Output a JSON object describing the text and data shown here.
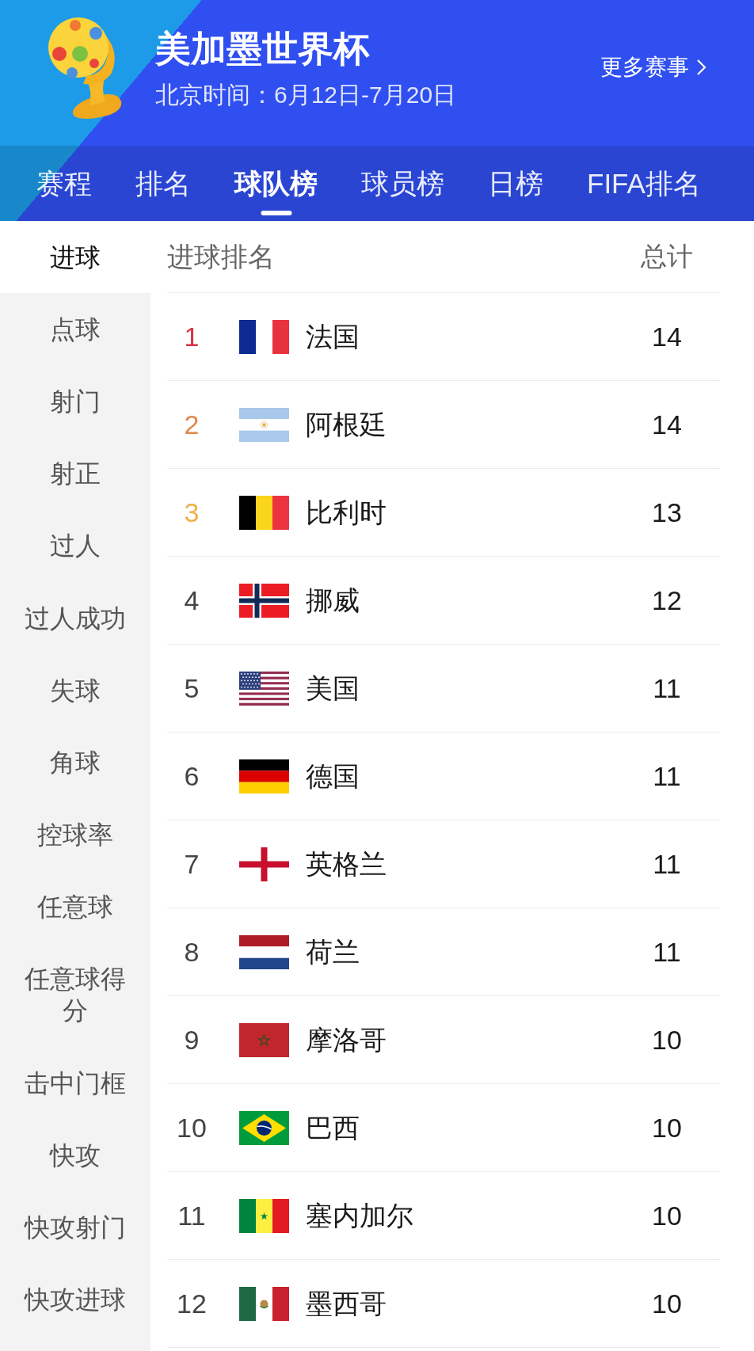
{
  "header": {
    "title": "美加墨世界杯",
    "subtitle": "北京时间：6月12日-7月20日",
    "more_link": "更多赛事"
  },
  "tabs": [
    {
      "label": "赛程",
      "selected": false
    },
    {
      "label": "排名",
      "selected": false
    },
    {
      "label": "球队榜",
      "selected": true
    },
    {
      "label": "球员榜",
      "selected": false
    },
    {
      "label": "日榜",
      "selected": false
    },
    {
      "label": "FIFA排名",
      "selected": false
    }
  ],
  "sidebar": {
    "items": [
      {
        "label": "进球",
        "selected": true
      },
      {
        "label": "点球",
        "selected": false
      },
      {
        "label": "射门",
        "selected": false
      },
      {
        "label": "射正",
        "selected": false
      },
      {
        "label": "过人",
        "selected": false
      },
      {
        "label": "过人成功",
        "selected": false
      },
      {
        "label": "失球",
        "selected": false
      },
      {
        "label": "角球",
        "selected": false
      },
      {
        "label": "控球率",
        "selected": false
      },
      {
        "label": "任意球",
        "selected": false
      },
      {
        "label": "任意球得分",
        "selected": false
      },
      {
        "label": "击中门框",
        "selected": false
      },
      {
        "label": "快攻",
        "selected": false
      },
      {
        "label": "快攻射门",
        "selected": false
      },
      {
        "label": "快攻进球",
        "selected": false
      }
    ]
  },
  "table": {
    "columns": [
      "进球排名",
      "总计"
    ],
    "rows": [
      {
        "rank": "1",
        "color": "#d7333f",
        "kind": "france",
        "team": "法国",
        "total": "14"
      },
      {
        "rank": "2",
        "color": "#e0884e",
        "kind": "argentina",
        "team": "阿根廷",
        "total": "14"
      },
      {
        "rank": "3",
        "color": "#eeb048",
        "kind": "belgium",
        "team": "比利时",
        "total": "13"
      },
      {
        "rank": "4",
        "color": "#444444",
        "kind": "norway",
        "team": "挪威",
        "total": "12"
      },
      {
        "rank": "5",
        "color": "#444444",
        "kind": "usa",
        "team": "美国",
        "total": "11"
      },
      {
        "rank": "6",
        "color": "#444444",
        "kind": "germany",
        "team": "德国",
        "total": "11"
      },
      {
        "rank": "7",
        "color": "#444444",
        "kind": "england",
        "team": "英格兰",
        "total": "11"
      },
      {
        "rank": "8",
        "color": "#444444",
        "kind": "netherlands",
        "team": "荷兰",
        "total": "11"
      },
      {
        "rank": "9",
        "color": "#444444",
        "kind": "morocco",
        "team": "摩洛哥",
        "total": "10"
      },
      {
        "rank": "10",
        "color": "#444444",
        "kind": "brazil",
        "team": "巴西",
        "total": "10"
      },
      {
        "rank": "11",
        "color": "#444444",
        "kind": "senegal",
        "team": "塞内加尔",
        "total": "10"
      },
      {
        "rank": "12",
        "color": "#444444",
        "kind": "mexico",
        "team": "墨西哥",
        "total": "10"
      }
    ]
  }
}
